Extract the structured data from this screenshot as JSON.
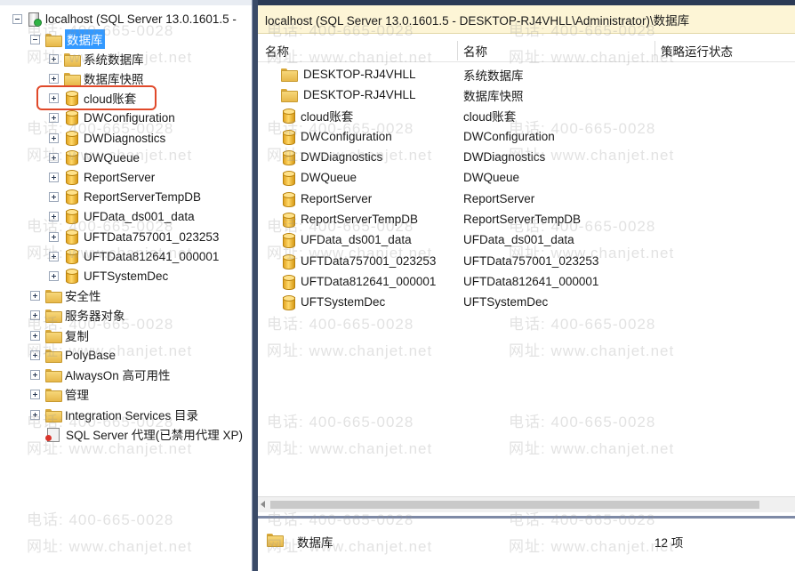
{
  "tree": {
    "server": "localhost (SQL Server 13.0.1601.5 -",
    "databases_folder": "数据库",
    "system_db_folder": "系统数据库",
    "snapshots_folder": "数据库快照",
    "databases": [
      "cloud账套",
      "DWConfiguration",
      "DWDiagnostics",
      "DWQueue",
      "ReportServer",
      "ReportServerTempDB",
      "UFData_ds001_data",
      "UFTData757001_023253",
      "UFTData812641_000001",
      "UFTSystemDec"
    ],
    "top_folders": [
      "安全性",
      "服务器对象",
      "复制",
      "PolyBase",
      "AlwaysOn 高可用性",
      "管理",
      "Integration Services 目录"
    ],
    "agent": "SQL Server 代理(已禁用代理 XP)"
  },
  "detail": {
    "path": "localhost (SQL Server 13.0.1601.5 - DESKTOP-RJ4VHLL\\Administrator)\\数据库",
    "columns": [
      "名称",
      "名称",
      "策略运行状态"
    ],
    "rows": [
      {
        "icon": "folder",
        "name": "DESKTOP-RJ4VHLL",
        "name2": "系统数据库"
      },
      {
        "icon": "folder",
        "name": "DESKTOP-RJ4VHLL",
        "name2": "数据库快照"
      },
      {
        "icon": "db",
        "name": "cloud账套",
        "name2": "cloud账套"
      },
      {
        "icon": "db",
        "name": "DWConfiguration",
        "name2": "DWConfiguration"
      },
      {
        "icon": "db",
        "name": "DWDiagnostics",
        "name2": "DWDiagnostics"
      },
      {
        "icon": "db",
        "name": "DWQueue",
        "name2": "DWQueue"
      },
      {
        "icon": "db",
        "name": "ReportServer",
        "name2": "ReportServer"
      },
      {
        "icon": "db",
        "name": "ReportServerTempDB",
        "name2": "ReportServerTempDB"
      },
      {
        "icon": "db",
        "name": "UFData_ds001_data",
        "name2": "UFData_ds001_data"
      },
      {
        "icon": "db",
        "name": "UFTData757001_023253",
        "name2": "UFTData757001_023253"
      },
      {
        "icon": "db",
        "name": "UFTData812641_000001",
        "name2": "UFTData812641_000001"
      },
      {
        "icon": "db",
        "name": "UFTSystemDec",
        "name2": "UFTSystemDec"
      }
    ],
    "status_left": "数据库",
    "status_right": "12 项"
  },
  "watermark": {
    "phone": "电话: 400-665-0028",
    "site": "网址: www.chanjet.net"
  },
  "colors": {
    "highlight": "#e0492a",
    "selected": "#3399ff",
    "path_bar": "#fdf5d6"
  }
}
